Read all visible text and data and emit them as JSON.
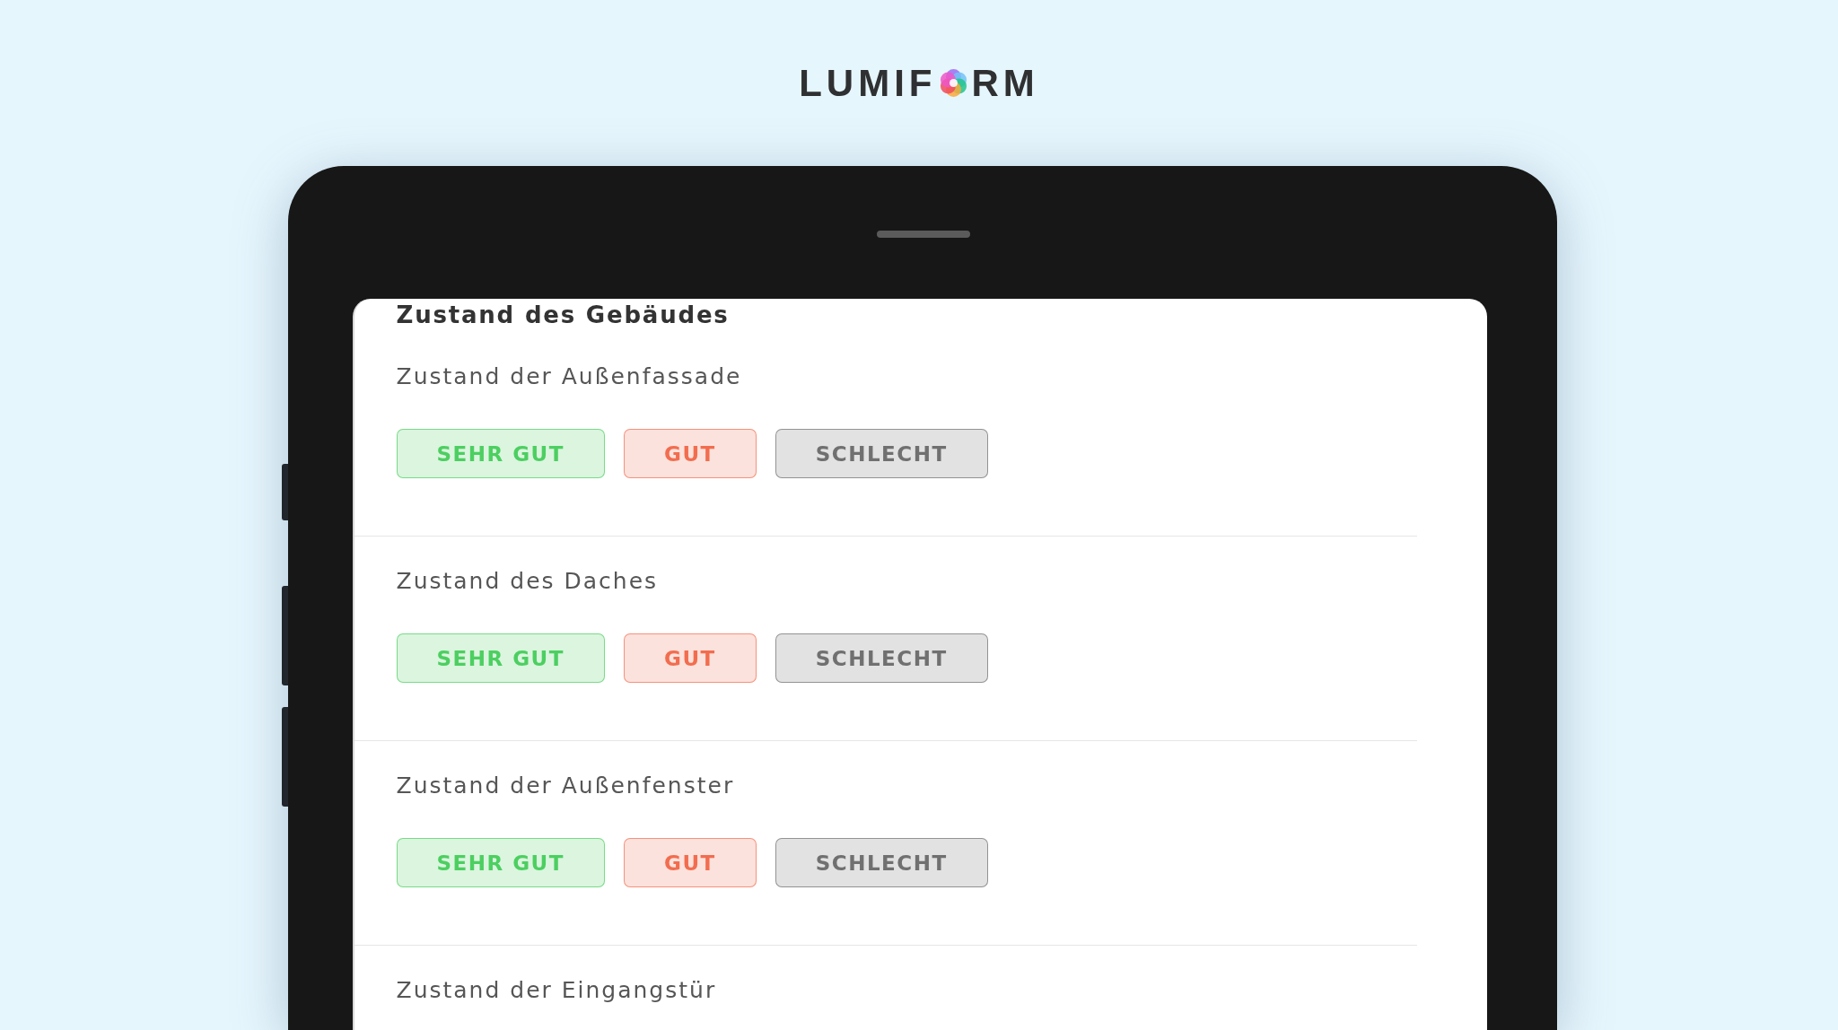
{
  "logo": {
    "text_before_mark": "LUMIF",
    "text_after_mark": "RM"
  },
  "form": {
    "title": "Zustand des Gebäudes",
    "questions": [
      {
        "label": "Zustand der Außenfassade",
        "options": [
          {
            "label": "SEHR GUT",
            "color": "#4ccf60"
          },
          {
            "label": "GUT",
            "color": "#f26d4f"
          },
          {
            "label": "SCHLECHT",
            "color": "#707070"
          }
        ]
      },
      {
        "label": "Zustand des Daches",
        "options": [
          {
            "label": "SEHR GUT",
            "color": "#4ccf60"
          },
          {
            "label": "GUT",
            "color": "#f26d4f"
          },
          {
            "label": "SCHLECHT",
            "color": "#707070"
          }
        ]
      },
      {
        "label": "Zustand der Außenfenster",
        "options": [
          {
            "label": "SEHR GUT",
            "color": "#4ccf60"
          },
          {
            "label": "GUT",
            "color": "#f26d4f"
          },
          {
            "label": "SCHLECHT",
            "color": "#707070"
          }
        ]
      },
      {
        "label": "Zustand der Eingangstür"
      }
    ]
  }
}
